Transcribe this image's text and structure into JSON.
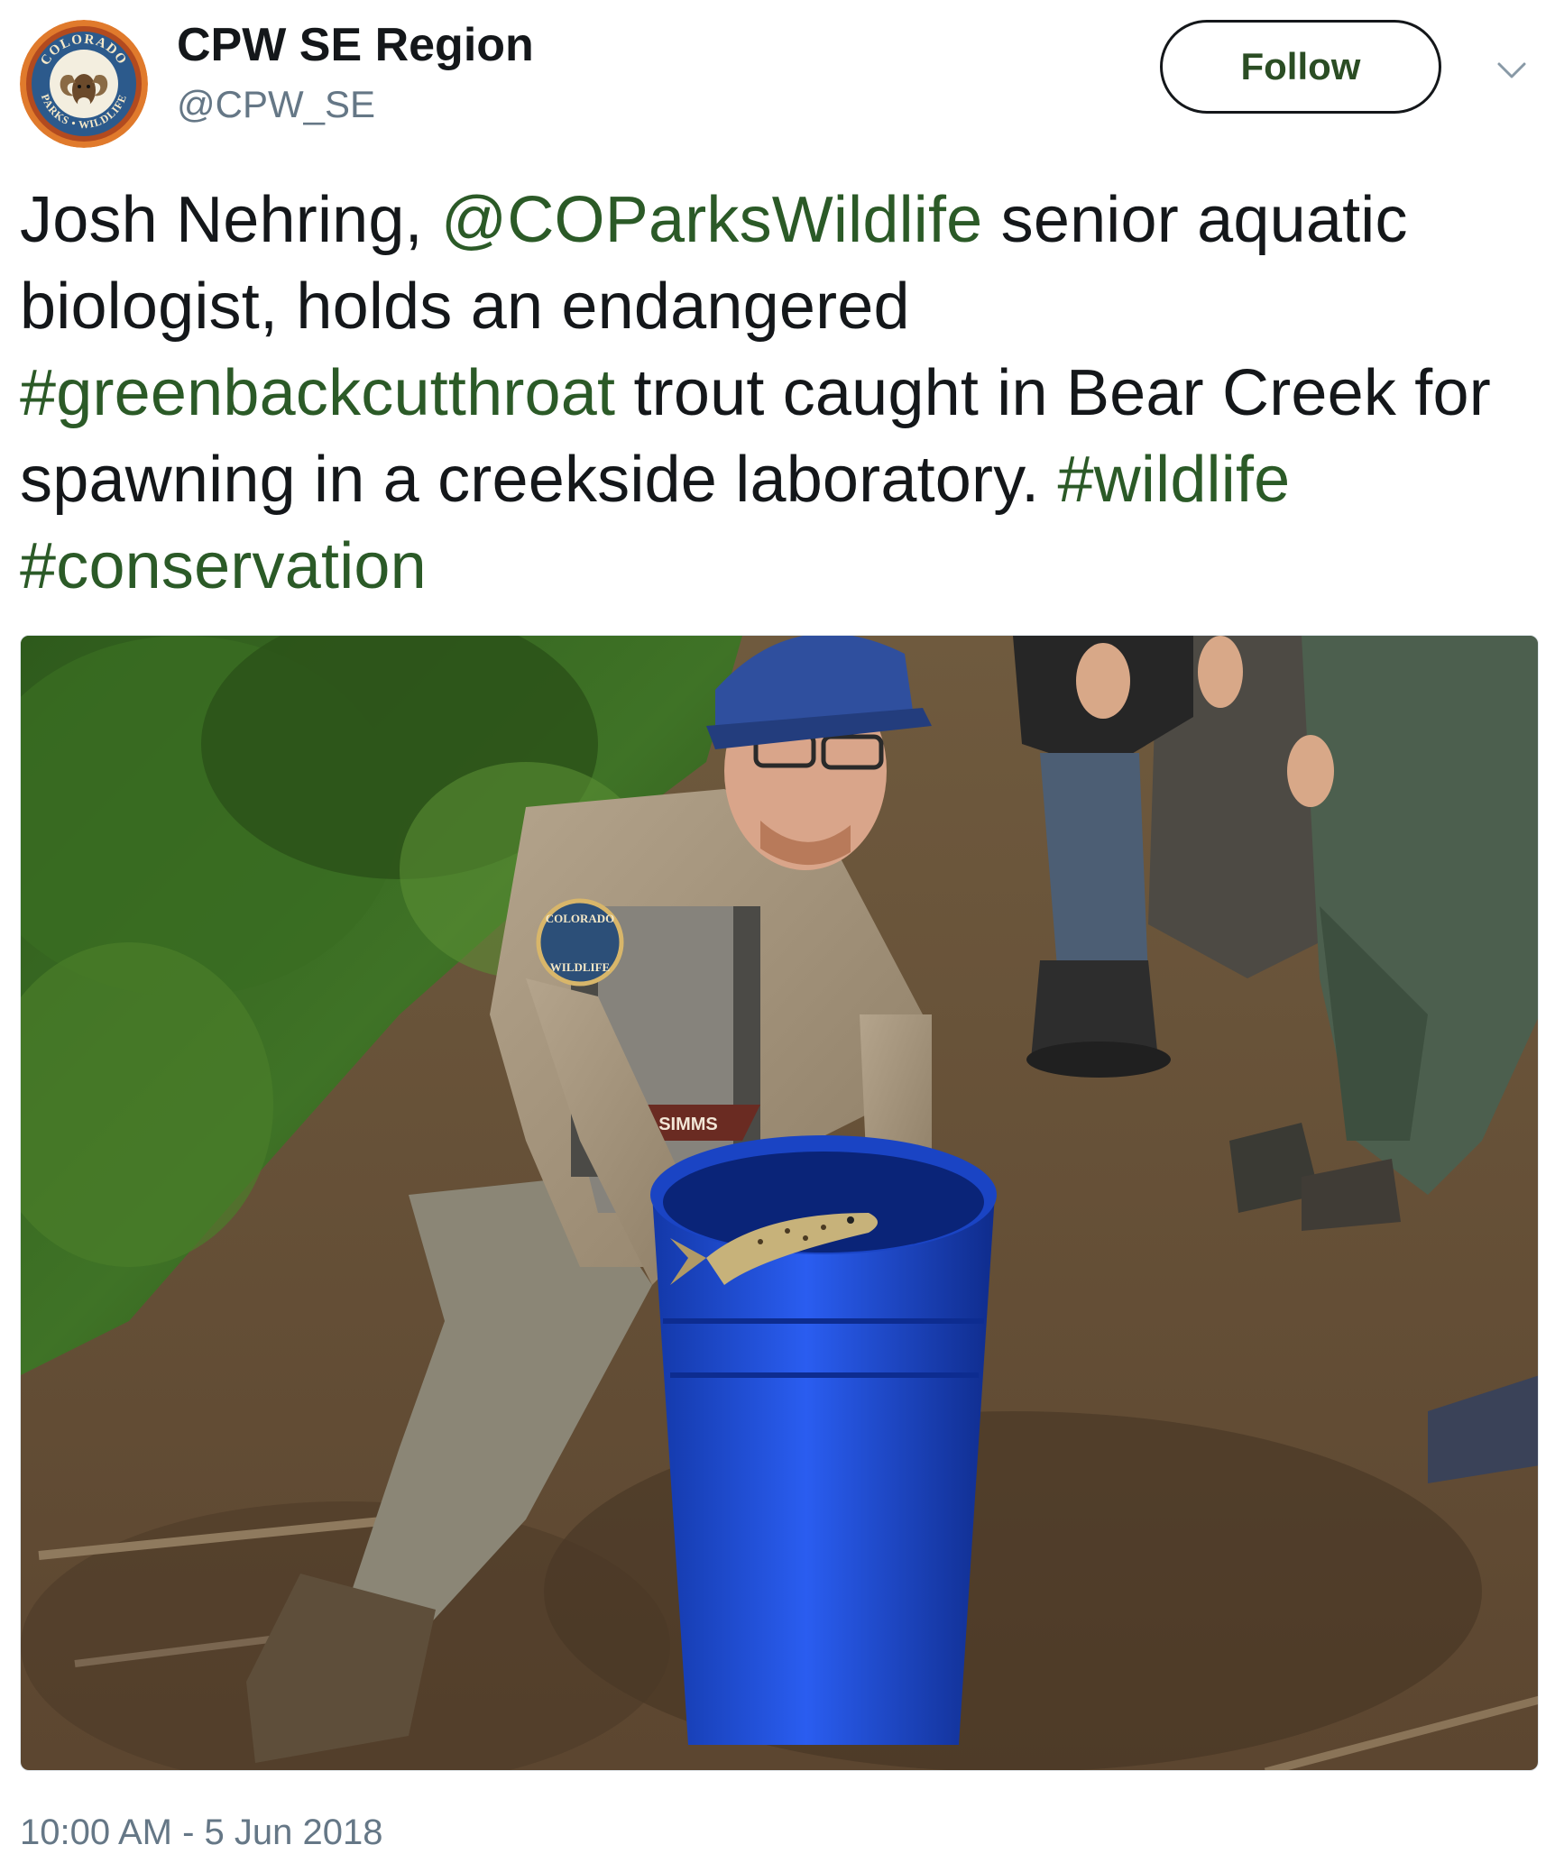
{
  "author": {
    "display_name": "CPW SE Region",
    "handle": "@CPW_SE",
    "avatar_icon": "colorado-parks-wildlife-logo-icon",
    "avatar_logo_top": "COLORADO",
    "avatar_logo_bottom": "PARKS • WILDLIFE"
  },
  "actions": {
    "follow_label": "Follow",
    "more_icon": "chevron-down-icon"
  },
  "tweet": {
    "segments": [
      {
        "text": "Josh Nehring, ",
        "link": false
      },
      {
        "text": "@COParksWildlife",
        "link": true
      },
      {
        "text": " senior aquatic biologist, holds an endangered ",
        "link": false
      },
      {
        "text": "#greenbackcutthroat",
        "link": true
      },
      {
        "text": " trout caught in Bear Creek for spawning in a creekside laboratory. ",
        "link": false
      },
      {
        "text": "#wildlife",
        "link": true
      },
      {
        "text": " ",
        "link": false
      },
      {
        "text": "#conservation",
        "link": true
      }
    ],
    "timestamp": "10:00 AM - 5 Jun 2018"
  },
  "media": {
    "uniform_patch_top": "COLORADO",
    "uniform_patch_bottom": "WILDLIFE",
    "waders_brand": "SIMMS"
  },
  "colors": {
    "link": "#2b5a27",
    "text": "#14171a",
    "secondary": "#657786",
    "bucket": "#1c4fd6",
    "cap": "#2f4f9e"
  }
}
